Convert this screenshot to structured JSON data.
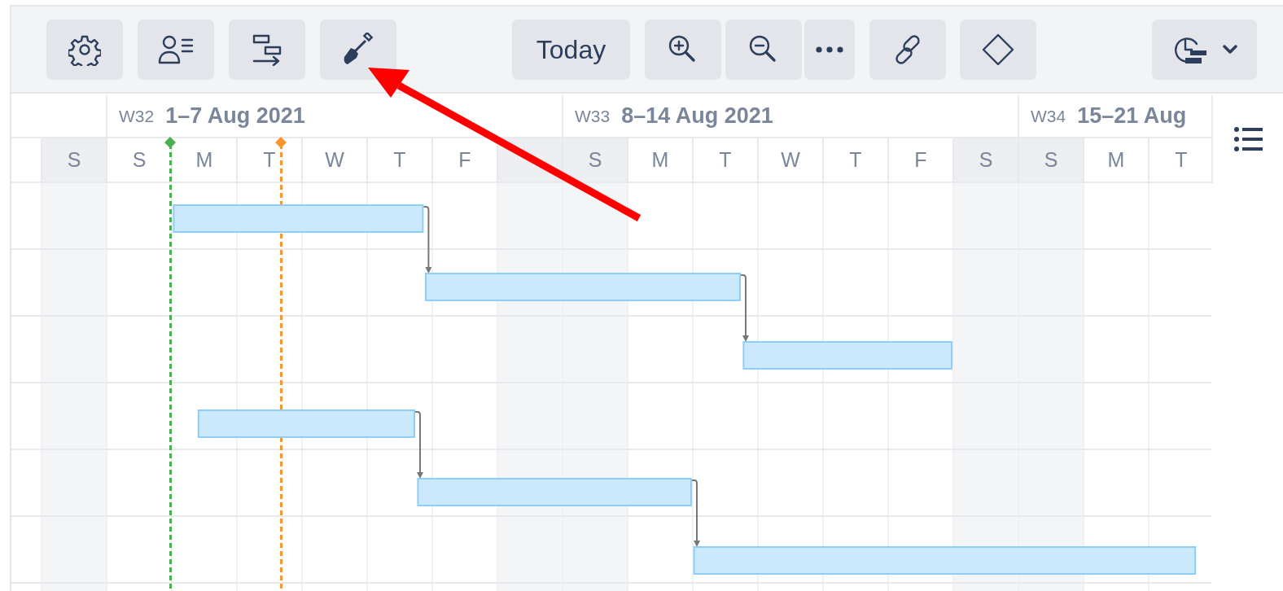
{
  "toolbar": [
    {
      "kind": "settings"
    },
    {
      "kind": "resources"
    },
    {
      "kind": "schedule"
    },
    {
      "kind": "shovel"
    },
    {
      "kind": "text",
      "label": "Today"
    },
    {
      "kind": "zoom-in"
    },
    {
      "kind": "zoom-out"
    },
    {
      "kind": "more"
    },
    {
      "kind": "link"
    },
    {
      "kind": "milestone"
    },
    {
      "kind": "baseline"
    }
  ],
  "weeks": [
    {
      "week": "W32",
      "range": "1–7 Aug 2021"
    },
    {
      "week": "W33",
      "range": "8–14 Aug 2021"
    },
    {
      "week": "W34",
      "range": "15–21 Aug"
    }
  ],
  "days": [
    {
      "label": "S",
      "weekend": true
    },
    {
      "label": "S",
      "weekend": false
    },
    {
      "label": "M",
      "weekend": false
    },
    {
      "label": "T",
      "weekend": false
    },
    {
      "label": "W",
      "weekend": false
    },
    {
      "label": "T",
      "weekend": false
    },
    {
      "label": "F",
      "weekend": false
    },
    {
      "weekend": true
    },
    {
      "label": "S",
      "weekend": true
    },
    {
      "label": "M",
      "weekend": false
    },
    {
      "label": "T",
      "weekend": false
    },
    {
      "label": "W",
      "weekend": false
    },
    {
      "label": "T",
      "weekend": false
    },
    {
      "label": "F",
      "weekend": false
    },
    {
      "label": "S",
      "weekend": true
    },
    {
      "label": "S",
      "weekend": true
    },
    {
      "label": "M",
      "weekend": false
    },
    {
      "label": "T",
      "weekend": false
    }
  ],
  "markers": [
    {
      "color": "#4caf50"
    },
    {
      "color": "#f7952f"
    }
  ],
  "tasks": [
    {
      "linked_to_previous": false
    },
    {
      "linked_to_previous": true
    },
    {
      "linked_to_previous": true
    },
    {
      "linked_to_previous": false
    },
    {
      "linked_to_previous": true
    },
    {
      "linked_to_previous": true
    }
  ]
}
